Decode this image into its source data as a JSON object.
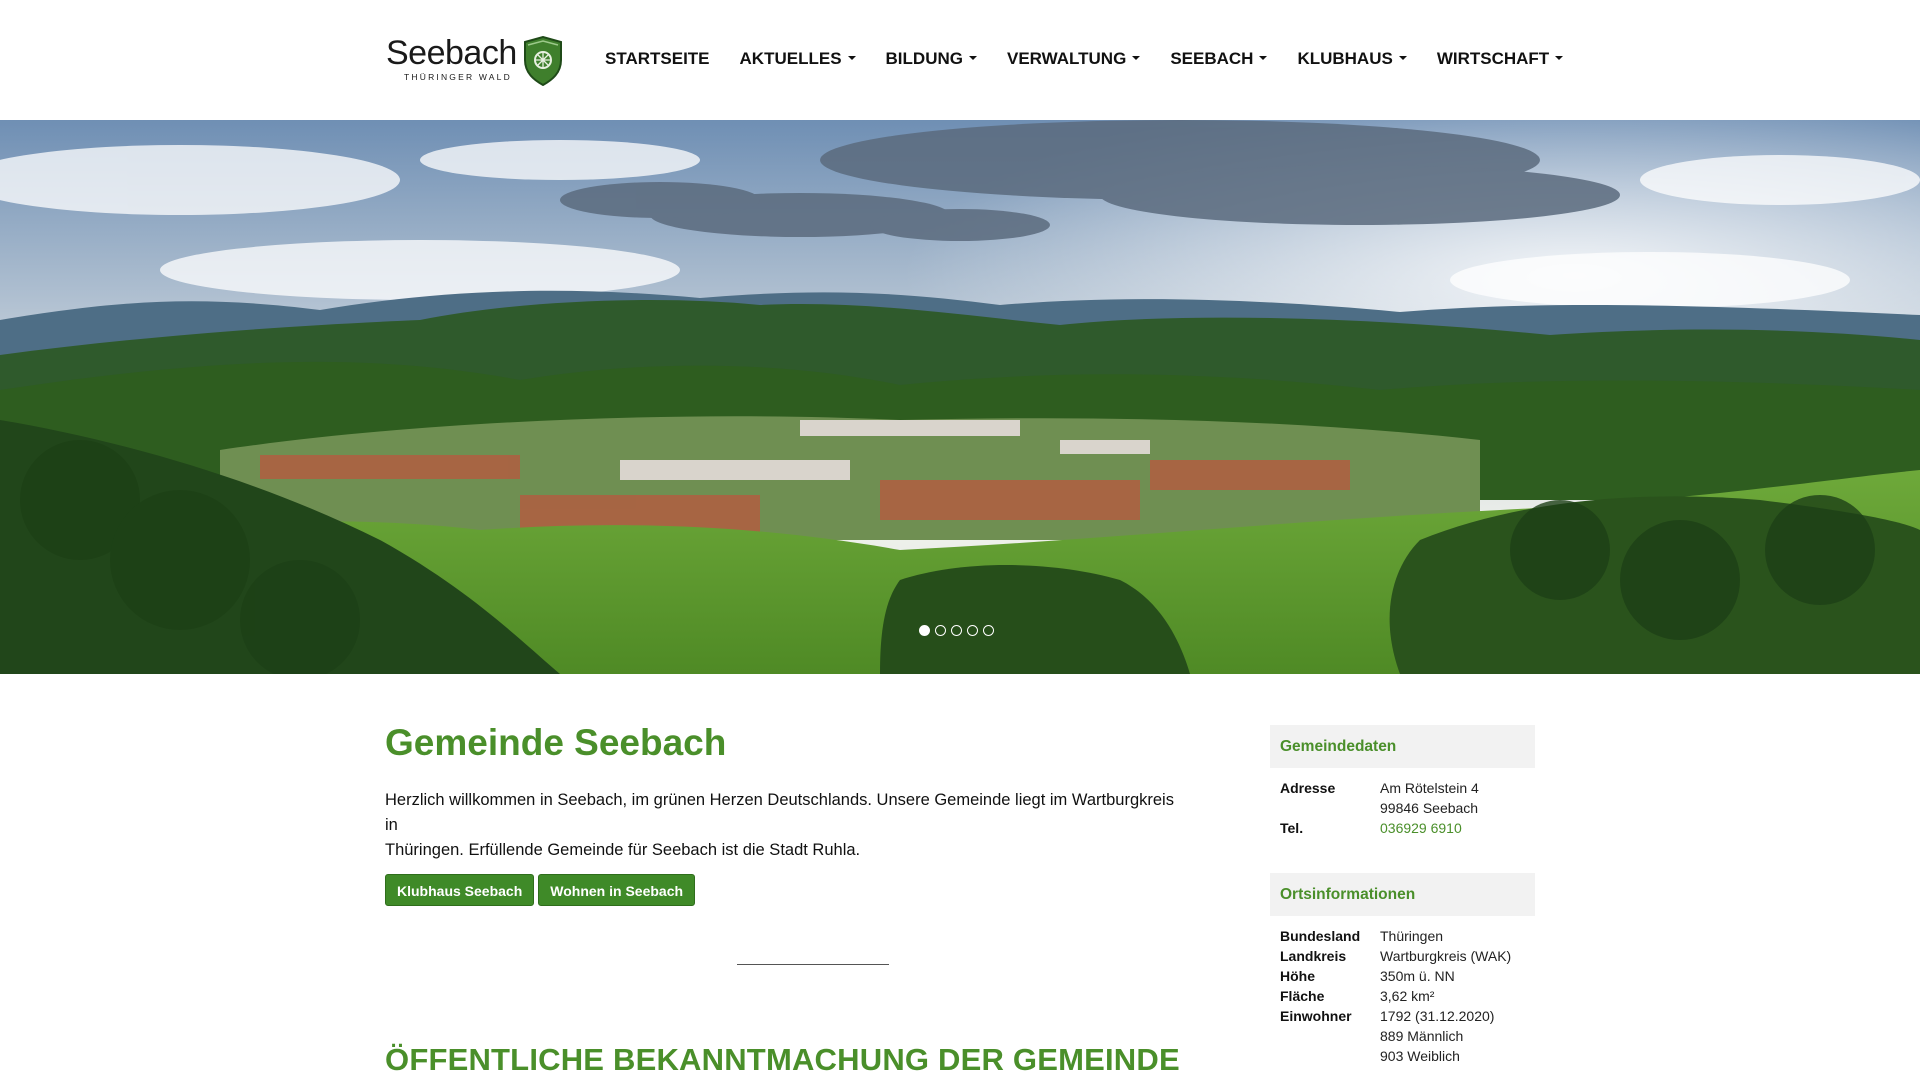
{
  "header": {
    "logo": {
      "wordmark": "Seebach",
      "subline": "THÜRINGER WALD"
    },
    "nav": [
      {
        "label": "STARTSEITE",
        "dropdown": false
      },
      {
        "label": "AKTUELLES",
        "dropdown": true
      },
      {
        "label": "BILDUNG",
        "dropdown": true
      },
      {
        "label": "VERWALTUNG",
        "dropdown": true
      },
      {
        "label": "SEEBACH",
        "dropdown": true
      },
      {
        "label": "KLUBHAUS",
        "dropdown": true
      },
      {
        "label": "WIRTSCHAFT",
        "dropdown": true
      }
    ]
  },
  "hero": {
    "slide_count": 5,
    "active_slide": 1
  },
  "main": {
    "title": "Gemeinde Seebach",
    "intro_line1": "Herzlich willkommen in Seebach, im grünen Herzen Deutschlands. Unsere Gemeinde liegt im Wartburgkreis in",
    "intro_line2": "Thüringen. Erfüllende Gemeinde für Seebach ist die Stadt Ruhla.",
    "buttons": [
      "Klubhaus Seebach",
      "Wohnen in Seebach"
    ],
    "section_title": "ÖFFENTLICHE BEKANNTMACHUNG DER GEMEINDE"
  },
  "sidebar": {
    "gemeindedaten": {
      "heading": "Gemeindedaten",
      "adresse_label": "Adresse",
      "adresse_line1": "Am Rötelstein 4",
      "adresse_line2": "99846 Seebach",
      "tel_label": "Tel.",
      "tel_value": "036929 6910"
    },
    "ortsinformationen": {
      "heading": "Ortsinformationen",
      "rows": [
        {
          "label": "Bundesland",
          "value": "Thüringen"
        },
        {
          "label": "Landkreis",
          "value": "Wartburgkreis (WAK)"
        },
        {
          "label": "Höhe",
          "value": "350m ü. NN"
        },
        {
          "label": "Fläche",
          "value": "3,62 km²"
        },
        {
          "label": "Einwohner",
          "value": "1792 (31.12.2020)"
        },
        {
          "label": "",
          "value": "889 Männlich"
        },
        {
          "label": "",
          "value": "903 Weiblich"
        }
      ]
    }
  },
  "colors": {
    "accent_green": "#4a8f2a",
    "button_green": "#3f8a28",
    "panel_bg": "#f2f2f2"
  }
}
